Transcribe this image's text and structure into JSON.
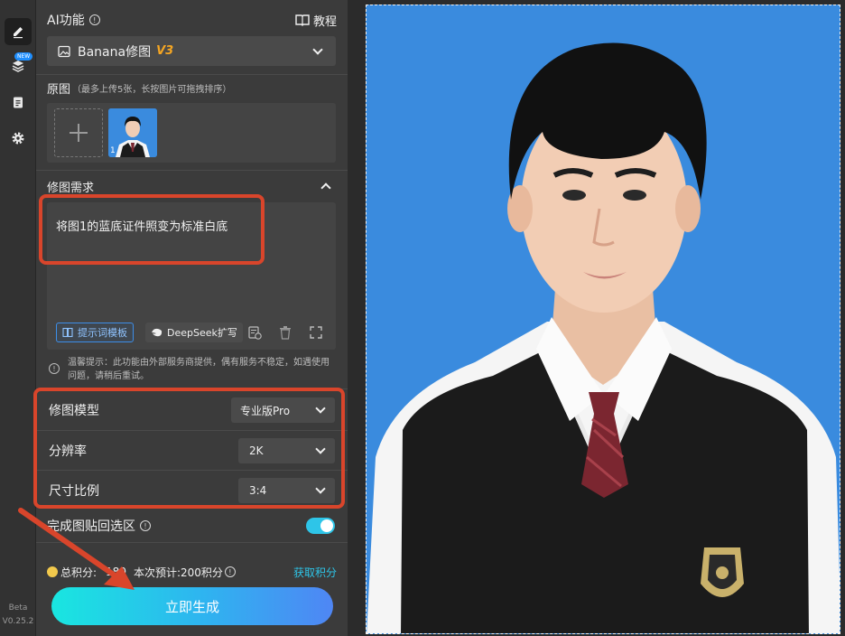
{
  "rail": {
    "new_badge": "NEW",
    "beta_label": "Beta",
    "version": "V0.25.2"
  },
  "panel": {
    "ai_title": "AI功能",
    "tutorial_label": "教程",
    "tool_select": {
      "name": "Banana修图",
      "tag": "V3"
    },
    "source": {
      "title": "原图",
      "note": "（最多上传5张，长按图片可拖拽排序）",
      "thumb_index": "1"
    },
    "request": {
      "title": "修图需求",
      "text": "将图1的蓝底证件照变为标准白底",
      "template_btn": "提示词模板",
      "deepseek_btn": "DeepSeek扩写"
    },
    "notice": "温馨提示：此功能由外部服务商提供，偶有服务不稳定，如遇使用问题，请稍后重试。",
    "settings": [
      {
        "label": "修图模型",
        "value": "专业版Pro"
      },
      {
        "label": "分辨率",
        "value": "2K"
      },
      {
        "label": "尺寸比例",
        "value": "3:4"
      }
    ],
    "paste_back": {
      "label": "完成图贴回选区",
      "enabled": true
    },
    "points": {
      "total_label": "总积分:",
      "total_value": "180",
      "estimate": "本次预计:200积分",
      "get_points": "获取积分"
    },
    "generate_btn": "立即生成"
  },
  "colors": {
    "accent_cyan": "#19e6e0",
    "accent_blue": "#4f86f4",
    "highlight_red": "#d9452b",
    "photo_bg": "#3a8bde",
    "tag_orange": "#f5a623"
  }
}
